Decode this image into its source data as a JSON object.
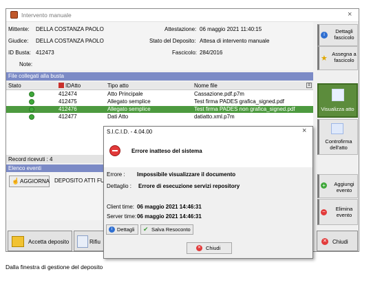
{
  "window": {
    "title": "Intervento manuale",
    "close": "×"
  },
  "header": {
    "mittente_label": "Mittente:",
    "mittente": "DELLA COSTANZA PAOLO",
    "giudice_label": "Giudice:",
    "giudice": "DELLA COSTANZA PAOLO",
    "idbusta_label": "ID Busta:",
    "idbusta": "412473",
    "note_label": "Note:",
    "attestazione_label": "Attestazione:",
    "attestazione": "06 maggio 2021 11:40:15",
    "stato_label": "Stato del Deposito:",
    "stato": "Attesa di intervento manuale",
    "fascicolo_label": "Fascicolo:",
    "fascicolo": "284/2016"
  },
  "side_buttons": {
    "dettagli": "Dettagli fascicolo",
    "assegna": "Assegna a fascicolo",
    "visualizza": "Visualizza atto",
    "controfirma": "Controfirma dell'atto",
    "aggiungi": "Aggiungi evento",
    "elimina": "Elimina evento"
  },
  "files": {
    "section_title": "File collegati alla busta",
    "columns": [
      "Stato",
      "IDAtto",
      "Tipo atto",
      "Nome file"
    ],
    "rows": [
      {
        "id": "412474",
        "tipo": "Atto Principale",
        "nome": "Cassazione.pdf.p7m"
      },
      {
        "id": "412475",
        "tipo": "Allegato semplice",
        "nome": "Test firma PADES grafica_signed.pdf"
      },
      {
        "id": "412476",
        "tipo": "Allegato semplice",
        "nome": "Test firma PADES non grafica_signed.pdf"
      },
      {
        "id": "412477",
        "tipo": "Dati Atto",
        "nome": "datiatto.xml.p7m"
      }
    ],
    "record_count": "Record ricevuti : 4"
  },
  "events": {
    "section_title": "Elenco eventi",
    "refresh_button": "AGGIORNA",
    "event_text": "DEPOSITO ATTI FUOR"
  },
  "bottom": {
    "accetta": "Accetta deposito",
    "rifiuta": "Rifiu",
    "chiudi": "Chiudi"
  },
  "dialog": {
    "title": "S.I.C.I.D. - 4.04.00",
    "close": "×",
    "heading": "Errore inatteso del sistema",
    "errore_label": "Errore :",
    "errore": "Impossibile visualizzare il documento",
    "dettaglio_label": "Dettaglio :",
    "dettaglio": "Errore di esecuzione servizi repository",
    "client_label": "Client time:",
    "client_time": "06 maggio 2021 14:46:31",
    "server_label": "Server time:",
    "server_time": "06 maggio 2021 14:46:31",
    "dettagli_button": "Dettagli",
    "salva_button": "Salva Resoconto",
    "chiudi_button": "Chiudi"
  },
  "caption": "Dalla finestra di gestione del deposito",
  "colors": {
    "section_bar": "#7b8ac6",
    "selected_row": "#4d9a3f",
    "accent_green": "#5c8c3c",
    "error_red": "#e23a3a"
  }
}
